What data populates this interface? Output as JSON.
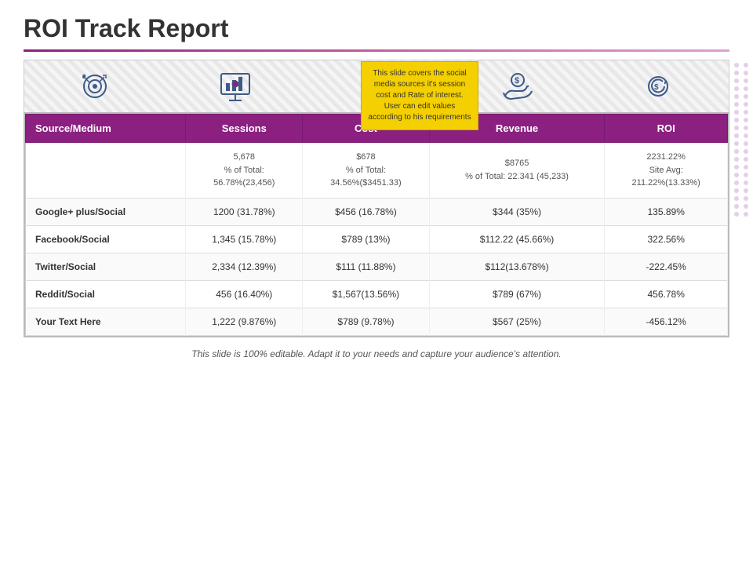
{
  "title": "ROI Track Report",
  "tooltip": {
    "text": "This slide covers the social media sources it's session cost and Rate of interest. User can edit values according to his requirements"
  },
  "icons": [
    {
      "name": "target-icon",
      "symbol": "🎯"
    },
    {
      "name": "chart-icon",
      "symbol": "📊"
    },
    {
      "name": "dollar-icon",
      "symbol": "💲"
    },
    {
      "name": "hand-coin-icon",
      "symbol": "🤝"
    },
    {
      "name": "refresh-coin-icon",
      "symbol": "🔄"
    }
  ],
  "table": {
    "headers": [
      "Source/Medium",
      "Sessions",
      "Cost",
      "Revenue",
      "ROI"
    ],
    "summary_row": {
      "sessions": "5,678\n% of Total:\n56.78%(23,456)",
      "cost": "$678\n% of Total:\n34.56%($3451.33)",
      "revenue": "$8765\n% of Total: 22.341 (45,233)",
      "roi": "2231.22%\nSite Avg:\n211.22%(13.33%)"
    },
    "rows": [
      {
        "source": "Google+ plus/Social",
        "sessions": "1200 (31.78%)",
        "cost": "$456 (16.78%)",
        "revenue": "$344 (35%)",
        "roi": "135.89%"
      },
      {
        "source": "Facebook/Social",
        "sessions": "1,345 (15.78%)",
        "cost": "$789 (13%)",
        "revenue": "$112.22 (45.66%)",
        "roi": "322.56%"
      },
      {
        "source": "Twitter/Social",
        "sessions": "2,334 (12.39%)",
        "cost": "$111 (11.88%)",
        "revenue": "$112(13.678%)",
        "roi": "-222.45%"
      },
      {
        "source": "Reddit/Social",
        "sessions": "456 (16.40%)",
        "cost": "$1,567(13.56%)",
        "revenue": "$789 (67%)",
        "roi": "456.78%"
      },
      {
        "source": "Your Text Here",
        "sessions": "1,222 (9.876%)",
        "cost": "$789 (9.78%)",
        "revenue": "$567 (25%)",
        "roi": "-456.12%"
      }
    ]
  },
  "footer": "This slide is 100% editable. Adapt it to your needs and capture your audience's attention."
}
